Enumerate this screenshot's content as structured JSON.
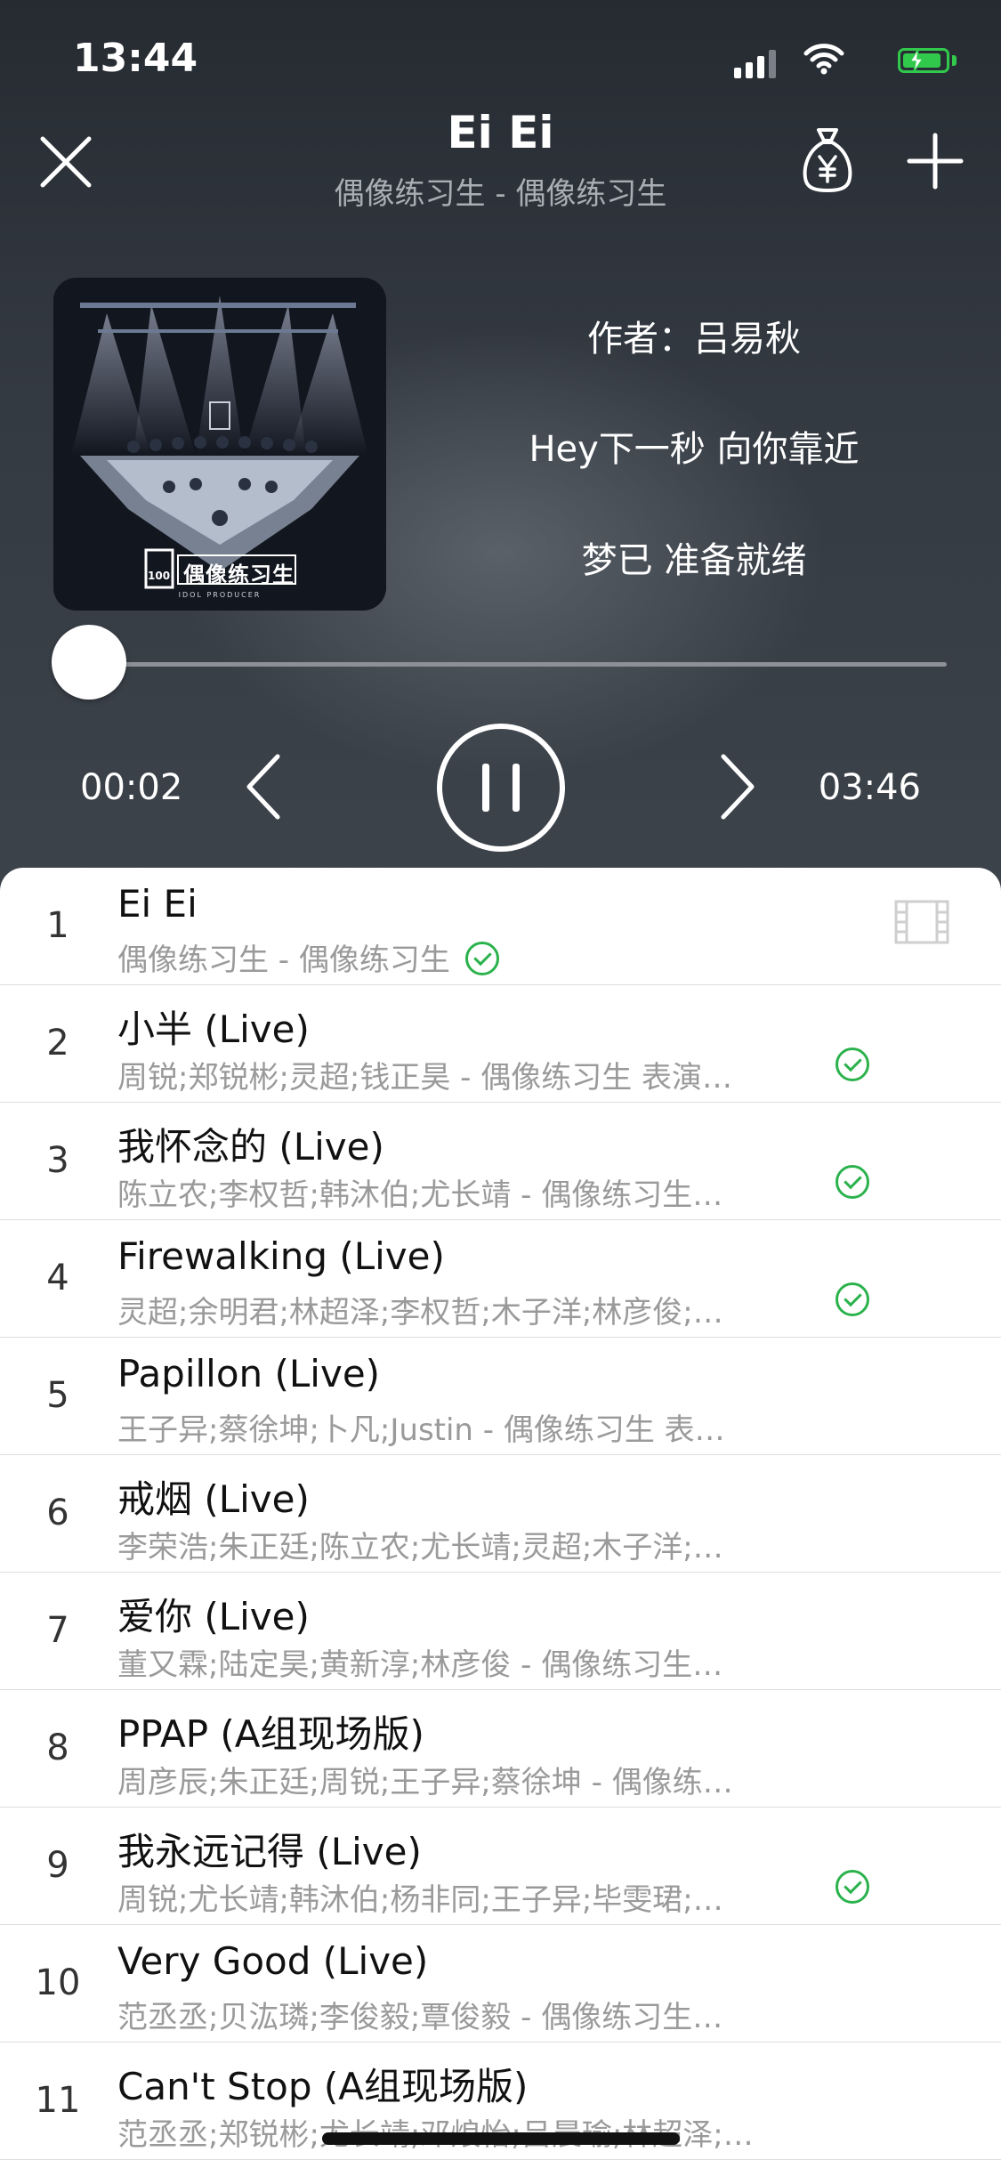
{
  "status_bar": {
    "time": "13:44"
  },
  "header": {
    "title": "Ei Ei",
    "subtitle": "偶像练习生 - 偶像练习生"
  },
  "lyrics": [
    "作者：吕易秋",
    "Hey下一秒 向你靠近",
    "梦已 准备就绪"
  ],
  "playback": {
    "elapsed": "00:02",
    "total": "03:46",
    "progress_fraction": 0.01
  },
  "cover": {
    "logo_text": "偶像练习生",
    "tag_text": "IDOL PRODUCER",
    "badge_text": "100"
  },
  "playlist": [
    {
      "num": "1",
      "title": "Ei Ei",
      "subtitle": "偶像练习生 - 偶像练习生",
      "downloaded": true,
      "inline_check": true,
      "has_mv": true
    },
    {
      "num": "2",
      "title": "小半 (Live)",
      "subtitle": "周锐;郑锐彬;灵超;钱正昊 - 偶像练习生 表演…",
      "downloaded": true
    },
    {
      "num": "3",
      "title": "我怀念的 (Live)",
      "subtitle": "陈立农;李权哲;韩沐伯;尤长靖 - 偶像练习生…",
      "downloaded": true
    },
    {
      "num": "4",
      "title": "Firewalking (Live)",
      "subtitle": "灵超;余明君;林超泽;李权哲;木子洋;林彦俊;…",
      "downloaded": true
    },
    {
      "num": "5",
      "title": "Papillon (Live)",
      "subtitle": "王子异;蔡徐坤;卜凡;Justin - 偶像练习生 表…",
      "downloaded": false
    },
    {
      "num": "6",
      "title": "戒烟 (Live)",
      "subtitle": "李荣浩;朱正廷;陈立农;尤长靖;灵超;木子洋;…",
      "downloaded": false
    },
    {
      "num": "7",
      "title": "爱你 (Live)",
      "subtitle": "董又霖;陆定昊;黄新淳;林彦俊 - 偶像练习生…",
      "downloaded": false
    },
    {
      "num": "8",
      "title": "PPAP (A组现场版)",
      "subtitle": "周彦辰;朱正廷;周锐;王子异;蔡徐坤 - 偶像练…",
      "downloaded": false
    },
    {
      "num": "9",
      "title": "我永远记得 (Live)",
      "subtitle": "周锐;尤长靖;韩沐伯;杨非同;王子异;毕雯珺;…",
      "downloaded": true
    },
    {
      "num": "10",
      "title": "Very Good (Live)",
      "subtitle": "范丞丞;贝汯璘;李俊毅;覃俊毅 - 偶像练习生…",
      "downloaded": false
    },
    {
      "num": "11",
      "title": "Can't Stop (A组现场版)",
      "subtitle": "范丞丞;郑锐彬;尤长靖;邓烺怡;吕晨瑜;林超泽;…",
      "downloaded": false
    }
  ],
  "colors": {
    "accent_green": "#2bb24c",
    "battery_green": "#31c94c",
    "player_bg": "#30353c",
    "subtext_gray": "#9a9a9a"
  },
  "icons": {
    "close": "close-icon",
    "reward": "yen-bag-icon",
    "add": "plus-icon",
    "prev": "chevron-left-icon",
    "pause": "pause-icon",
    "next": "chevron-right-icon",
    "mv": "film-icon",
    "downloaded": "check-circle-icon"
  }
}
